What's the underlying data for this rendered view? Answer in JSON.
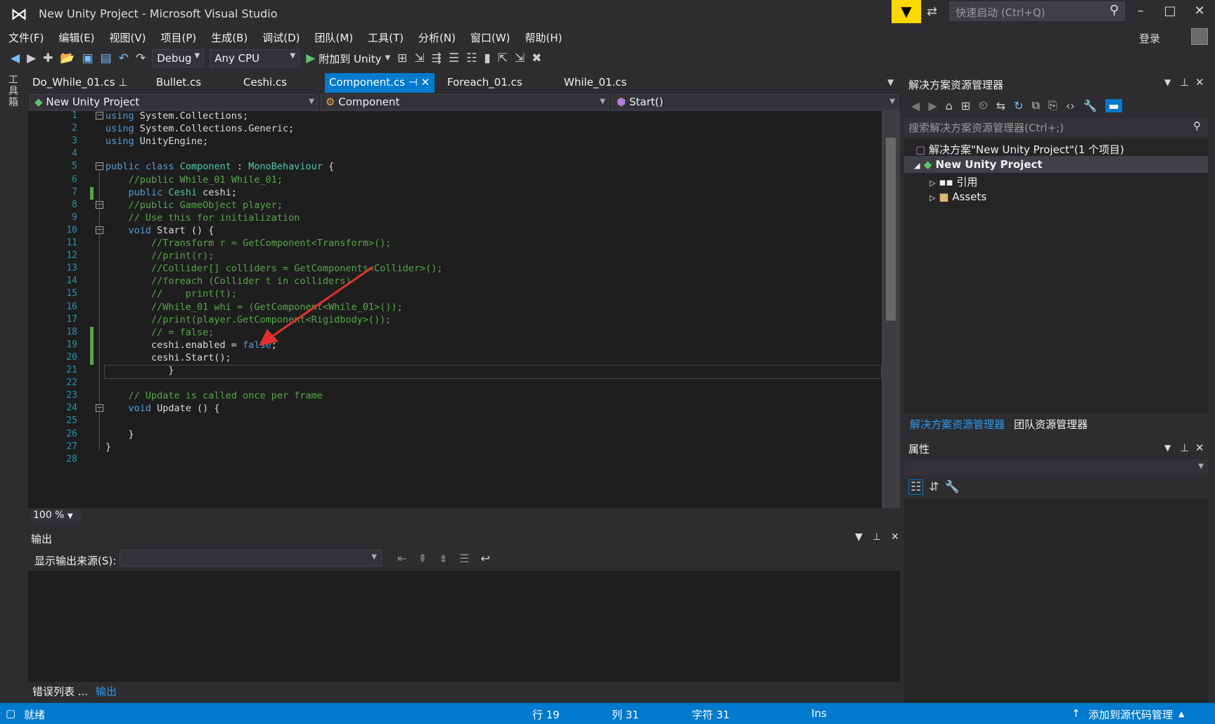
{
  "window": {
    "title": "New Unity Project - Microsoft Visual Studio",
    "quick_launch_placeholder": "快速启动 (Ctrl+Q)",
    "login": "登录"
  },
  "menu": [
    "文件(F)",
    "编辑(E)",
    "视图(V)",
    "项目(P)",
    "生成(B)",
    "调试(D)",
    "团队(M)",
    "工具(T)",
    "分析(N)",
    "窗口(W)",
    "帮助(H)"
  ],
  "toolbar": {
    "config": "Debug",
    "platform": "Any CPU",
    "attach": "附加到 Unity"
  },
  "toolbox_label": "工具箱",
  "tabs": [
    "Do_While_01.cs",
    "Bullet.cs",
    "Ceshi.cs",
    "Component.cs",
    "Foreach_01.cs",
    "While_01.cs"
  ],
  "active_tab": "Component.cs",
  "nav": {
    "project": "New Unity Project",
    "class": "Component",
    "member": "Start()"
  },
  "code_lines": [
    "using System.Collections;",
    "using System.Collections.Generic;",
    "using UnityEngine;",
    "",
    "public class Component : MonoBehaviour {",
    "    //public While_01 While_01;",
    "    public Ceshi ceshi;",
    "    //public GameObject player;",
    "    // Use this for initialization",
    "    void Start () {",
    "        //Transform r = GetComponent<Transform>();",
    "        //print(r);",
    "        //Collider[] colliders = GetComponents<Collider>();",
    "        //foreach (Collider t in colliders)",
    "        //    print(t);",
    "        //While_01 whi = (GetComponent<While_01>());",
    "        //print(player.GetComponent<Rigidbody>());",
    "        // = false;",
    "        ceshi.enabled = false;",
    "        ceshi.Start();",
    "           }",
    "",
    "    // Update is called once per frame",
    "    void Update () {",
    "",
    "    }",
    "}",
    ""
  ],
  "zoom": "100 %",
  "output": {
    "title": "输出",
    "source_label": "显示输出来源(S):"
  },
  "bottom_tabs": [
    "错误列表 ...",
    "输出"
  ],
  "solution_explorer": {
    "title": "解决方案资源管理器",
    "search_placeholder": "搜索解决方案资源管理器(Ctrl+;)",
    "solution": "解决方案\"New Unity Project\"(1 个项目)",
    "project": "New Unity Project",
    "refs": "引用",
    "assets": "Assets",
    "tab1": "解决方案资源管理器",
    "tab2": "团队资源管理器"
  },
  "properties": {
    "title": "属性"
  },
  "status": {
    "ready": "就绪",
    "line": "行 19",
    "col": "列 31",
    "char": "字符 31",
    "ins": "Ins",
    "source_control": "添加到源代码管理"
  },
  "colors": {
    "accent": "#007acc",
    "keyword": "#569cd6",
    "type": "#4ec9b0",
    "comment": "#57a64a"
  }
}
